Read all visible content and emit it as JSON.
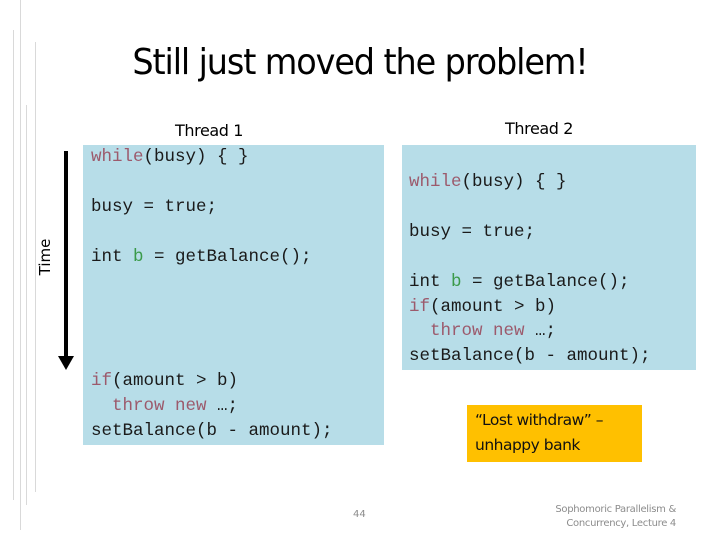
{
  "slide": {
    "title": "Still just moved the problem!",
    "time_label": "Time",
    "page_number": "44",
    "footer_line1": "Sophomoric Parallelism &",
    "footer_line2": "Concurrency, Lecture 4"
  },
  "thread1": {
    "label": "Thread 1",
    "lines": {
      "l1_kw": "while",
      "l1_rest": "(busy) { }",
      "l2": "busy = true;",
      "l3_a": "int ",
      "l3_var": "b",
      "l3_rest": " = getBalance();",
      "l4_kw": "if",
      "l4_rest": "(amount > b)",
      "l5_indent": "  ",
      "l5_kw": "throw new",
      "l5_rest": " …;",
      "l6": "setBalance(b - amount);"
    }
  },
  "thread2": {
    "label": "Thread 2",
    "lines": {
      "l1_kw": "while",
      "l1_rest": "(busy) { }",
      "l2": "busy = true;",
      "l3_a": "int ",
      "l3_var": "b",
      "l3_rest": " = getBalance();",
      "l4_kw": "if",
      "l4_rest": "(amount > b)",
      "l5_indent": "  ",
      "l5_kw": "throw new",
      "l5_rest": " …;",
      "l6": "setBalance(b - amount);"
    }
  },
  "callout": {
    "line1": "“Lost withdraw” –",
    "line2": "unhappy bank"
  },
  "colors": {
    "code_box": "#b7dde8",
    "keyword": "#9c5a6c",
    "variable": "#3a9a4a",
    "callout": "#ffc000"
  }
}
